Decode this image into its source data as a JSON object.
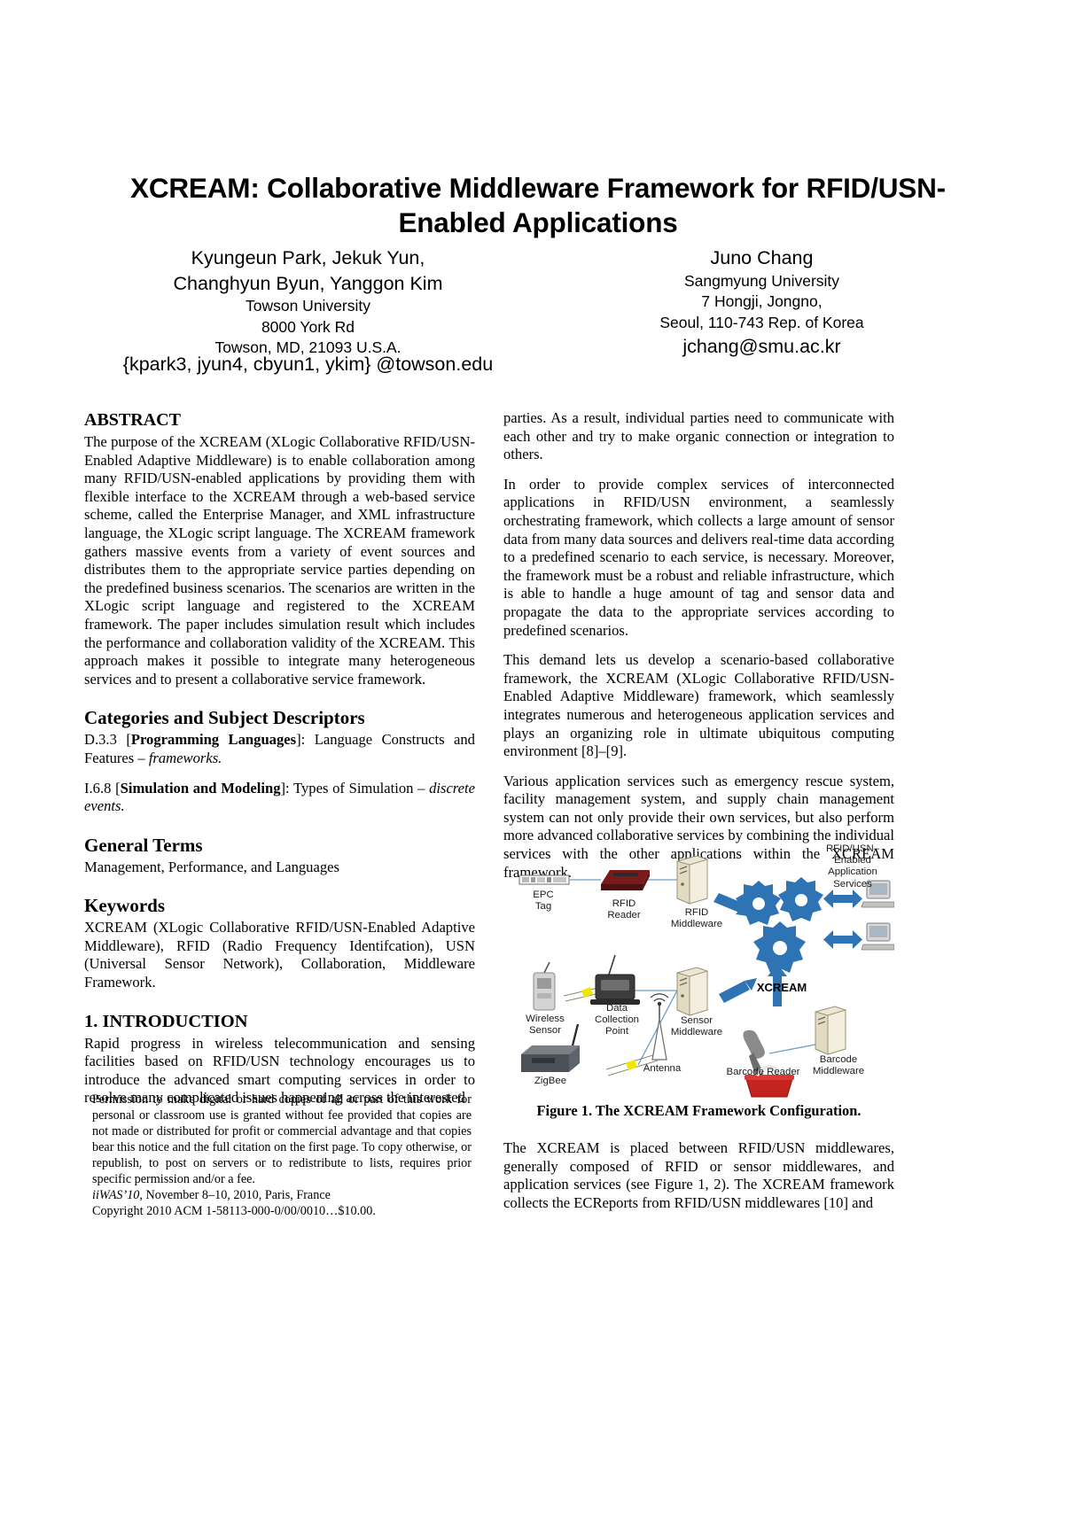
{
  "paper": {
    "title": "XCREAM: Collaborative Middleware Framework for RFID/USN-Enabled Applications",
    "authors": {
      "left": {
        "names": "Kyungeun Park, Jekuk Yun,\nChanghyun Byun,  Yanggon Kim",
        "affiliation": "Towson University",
        "address1": "8000 York Rd",
        "address2": "Towson, MD, 21093 U.S.A.",
        "email": "{kpark3, jyun4, cbyun1, ykim}\n@towson.edu"
      },
      "right": {
        "names": "Juno Chang",
        "affiliation": "Sangmyung University",
        "address1": "7 Hongji, Jongno,",
        "address2": "Seoul, 110-743 Rep. of Korea",
        "email": "jchang@smu.ac.kr"
      }
    }
  },
  "sections": {
    "abstract": {
      "heading": "ABSTRACT",
      "text": "The purpose of the XCREAM (XLogic Collaborative RFID/USN-Enabled Adaptive Middleware) is to enable collaboration among many RFID/USN-enabled applications by providing them with flexible interface to the XCREAM through a web-based service scheme, called the Enterprise Manager, and XML infrastructure language, the XLogic script language. The XCREAM framework gathers massive events from a variety of event sources and distributes them to the appropriate service parties depending on the predefined business scenarios. The scenarios are written in the XLogic script language and registered to the XCREAM framework. The paper includes simulation result which includes the performance and collaboration validity of the XCREAM. This approach makes it possible to integrate many heterogeneous services and to present a collaborative service framework."
    },
    "categories": {
      "heading": "Categories and Subject Descriptors",
      "entry1_prefix": "D.3.3 [",
      "entry1_bold": "Programming Languages",
      "entry1_mid": "]: Language Constructs and Features – ",
      "entry1_italic": "frameworks.",
      "entry2_prefix": "I.6.8 [",
      "entry2_bold": "Simulation and Modeling",
      "entry2_mid": "]: Types of Simulation – ",
      "entry2_italic": "discrete events."
    },
    "general_terms": {
      "heading": "General Terms",
      "text": "Management, Performance, and Languages"
    },
    "keywords": {
      "heading": "Keywords",
      "text": "XCREAM (XLogic Collaborative RFID/USN-Enabled Adaptive Middleware), RFID (Radio Frequency Identifcation), USN (Universal Sensor Network), Collaboration, Middleware Framework."
    },
    "introduction": {
      "heading": "1.  INTRODUCTION",
      "para1": "Rapid progress in wireless telecommunication and sensing facilities based on RFID/USN technology encourages us to introduce the advanced smart computing services in order to resolve many complicated issues happening across the interested",
      "para1_cont": "parties. As a result, individual parties need to communicate with each other and try to make organic connection or integration to others.",
      "para2": "In order to provide complex services of interconnected applications in RFID/USN environment, a seamlessly orchestrating framework, which collects a large amount of sensor data from many data sources and delivers real-time data according to a predefined scenario to each service, is necessary. Moreover, the framework must be a robust and reliable infrastructure, which is able to handle a huge amount of tag and sensor data and propagate the data to the appropriate services according to predefined scenarios.",
      "para3": "This demand lets us develop a scenario-based collaborative framework, the XCREAM (XLogic Collaborative RFID/USN-Enabled Adaptive Middleware) framework, which seamlessly integrates numerous and heterogeneous application services and plays an organizing role in ultimate ubiquitous computing environment [8]–[9].",
      "para4": "Various application services such as emergency rescue system, facility management system, and supply chain management system can not only provide their own services, but also perform more advanced collaborative services by combining the individual services with the other applications within the XCREAM framework.",
      "para5": "The XCREAM is placed between RFID/USN middlewares, generally composed of RFID or sensor middlewares, and application services (see Figure 1, 2). The XCREAM framework collects the ECReports from RFID/USN middlewares [10] and"
    }
  },
  "copyright": {
    "body": "Permission to make digital or hard copies of all or part of this work for personal or classroom use is granted without fee provided that copies are not made or distributed for profit or commercial advantage and that copies bear this notice and the full citation on the first page. To copy otherwise, or republish, to post on servers or to redistribute to lists, requires prior specific permission and/or a fee.",
    "conference_italic": "iiWAS’10",
    "conference_rest": ", November 8–10, 2010, Paris, France",
    "copyright_line": "Copyright 2010 ACM 1-58113-000-0/00/0010…$10.00."
  },
  "figure": {
    "caption": "Figure 1. The XCREAM Framework Configuration.",
    "labels": {
      "epc_tag": "EPC\nTag",
      "rfid_reader": "RFID\nReader",
      "rfid_middleware": "RFID\nMiddleware",
      "wireless_sensor": "Wireless\nSensor",
      "data_collection_point": "Data\nCollection\nPoint",
      "sensor_middleware": "Sensor\nMiddleware",
      "zigbee": "ZigBee",
      "antenna": "Antenna",
      "barcode_reader": "Barcode Reader",
      "barcode_middleware": "Barcode\nMiddleware",
      "xcream": "XCREAM",
      "app_services": "RFID/USN–\nEnabled\nApplication\nServices"
    },
    "colors": {
      "gear_blue": "#2E74B5",
      "arrow_blue": "#2E74B5",
      "link_line": "#6A9EC9",
      "device_grey": "#808080",
      "server_cream": "#E8E2CD",
      "basket_red": "#C3241E"
    }
  }
}
